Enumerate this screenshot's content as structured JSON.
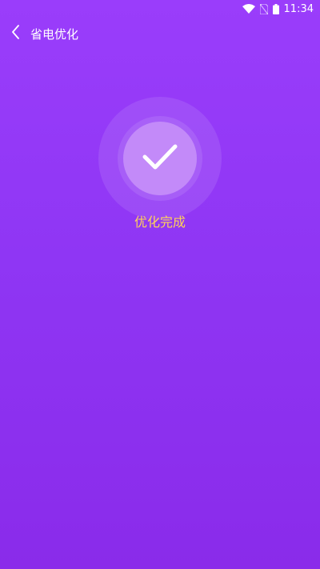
{
  "status_bar": {
    "time": "11:34",
    "icons": [
      "wifi-icon",
      "no-sim-icon",
      "battery-icon"
    ]
  },
  "header": {
    "back_icon": "chevron-left-icon",
    "title": "省电优化"
  },
  "result": {
    "icon": "check-icon",
    "label": "优化完成"
  },
  "colors": {
    "background_top": "#9a3dfb",
    "background_bottom": "#8a2bea",
    "circle_inner": "#c38af9",
    "label": "#ffd25a"
  }
}
